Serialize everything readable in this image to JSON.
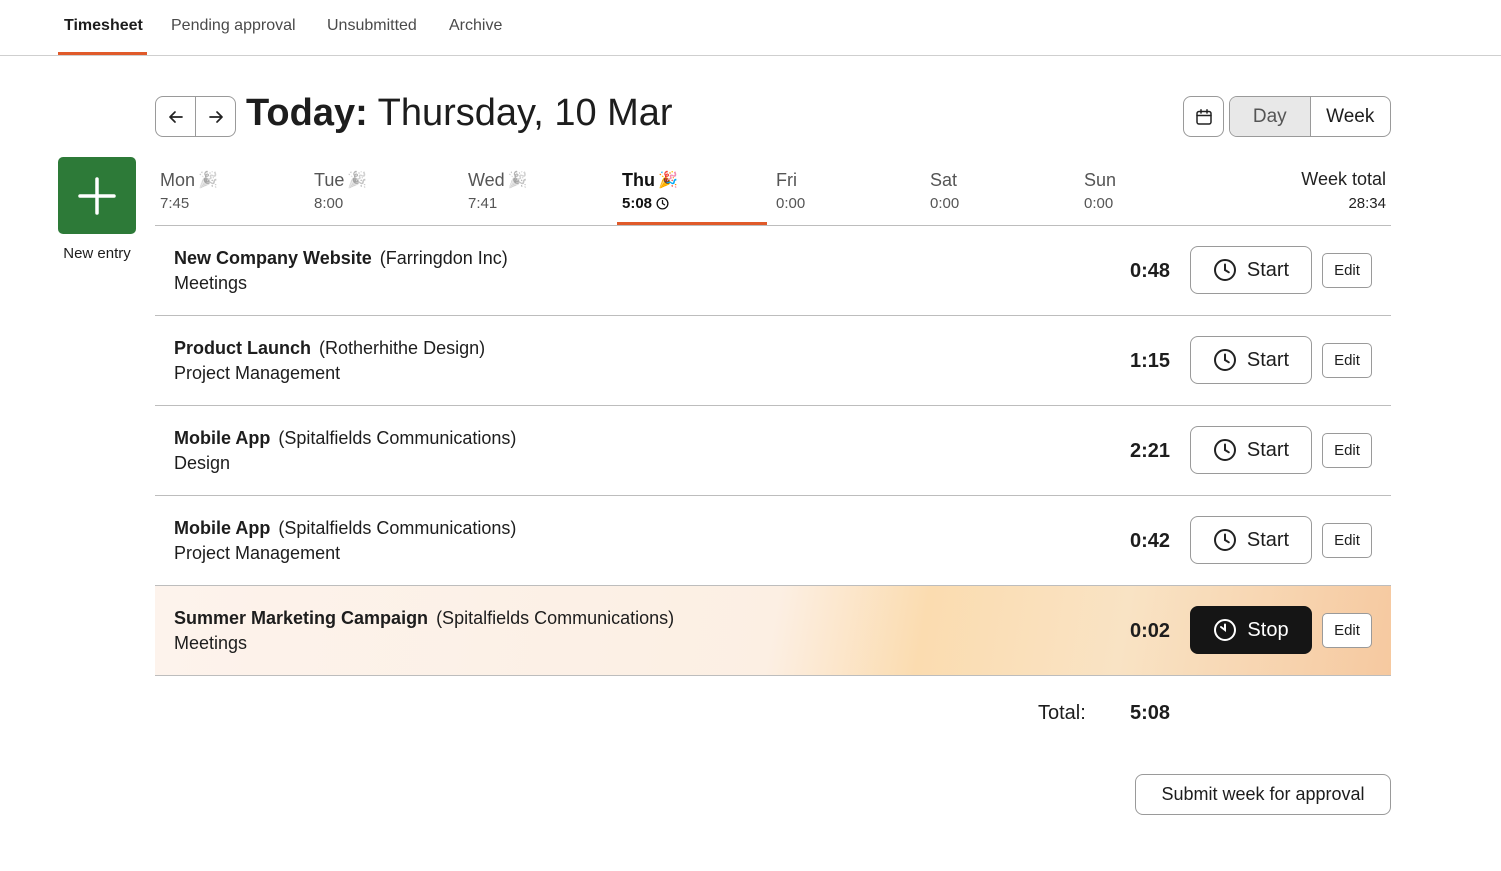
{
  "tabs": [
    {
      "label": "Timesheet",
      "active": true
    },
    {
      "label": "Pending approval"
    },
    {
      "label": "Unsubmitted"
    },
    {
      "label": "Archive"
    }
  ],
  "header": {
    "title_prefix": "Today:",
    "title_date": "Thursday, 10 Mar",
    "prev_icon": "arrow-left-icon",
    "next_icon": "arrow-right-icon",
    "calendar_icon": "calendar-icon",
    "view_day": "Day",
    "view_week": "Week",
    "selected_view": "Day"
  },
  "new_entry": {
    "label": "New entry",
    "color": "#2d7a38"
  },
  "days": [
    {
      "name": "Mon",
      "time": "7:45",
      "emoji": "🎉"
    },
    {
      "name": "Tue",
      "time": "8:00",
      "emoji": "🎉"
    },
    {
      "name": "Wed",
      "time": "7:41",
      "emoji": "🎉"
    },
    {
      "name": "Thu",
      "time": "5:08",
      "emoji": "🎉",
      "current": true
    },
    {
      "name": "Fri",
      "time": "0:00"
    },
    {
      "name": "Sat",
      "time": "0:00"
    },
    {
      "name": "Sun",
      "time": "0:00"
    }
  ],
  "week_total": {
    "label": "Week total",
    "value": "28:34"
  },
  "entries": [
    {
      "project": "New Company Website",
      "client": "(Farringdon Inc)",
      "task": "Meetings",
      "duration": "0:48",
      "action": "Start",
      "edit": "Edit"
    },
    {
      "project": "Product Launch",
      "client": "(Rotherhithe Design)",
      "task": "Project Management",
      "duration": "1:15",
      "action": "Start",
      "edit": "Edit"
    },
    {
      "project": "Mobile App",
      "client": "(Spitalfields Communications)",
      "task": "Design",
      "duration": "2:21",
      "action": "Start",
      "edit": "Edit"
    },
    {
      "project": "Mobile App",
      "client": "(Spitalfields Communications)",
      "task": "Project Management",
      "duration": "0:42",
      "action": "Start",
      "edit": "Edit"
    },
    {
      "project": "Summer Marketing Campaign",
      "client": "(Spitalfields Communications)",
      "task": "Meetings",
      "duration": "0:02",
      "action": "Stop",
      "edit": "Edit",
      "running": true
    }
  ],
  "total": {
    "label": "Total:",
    "value": "5:08"
  },
  "submit_label": "Submit week for approval",
  "colors": {
    "accent": "#e05a2a",
    "stop_button": "#151515"
  }
}
